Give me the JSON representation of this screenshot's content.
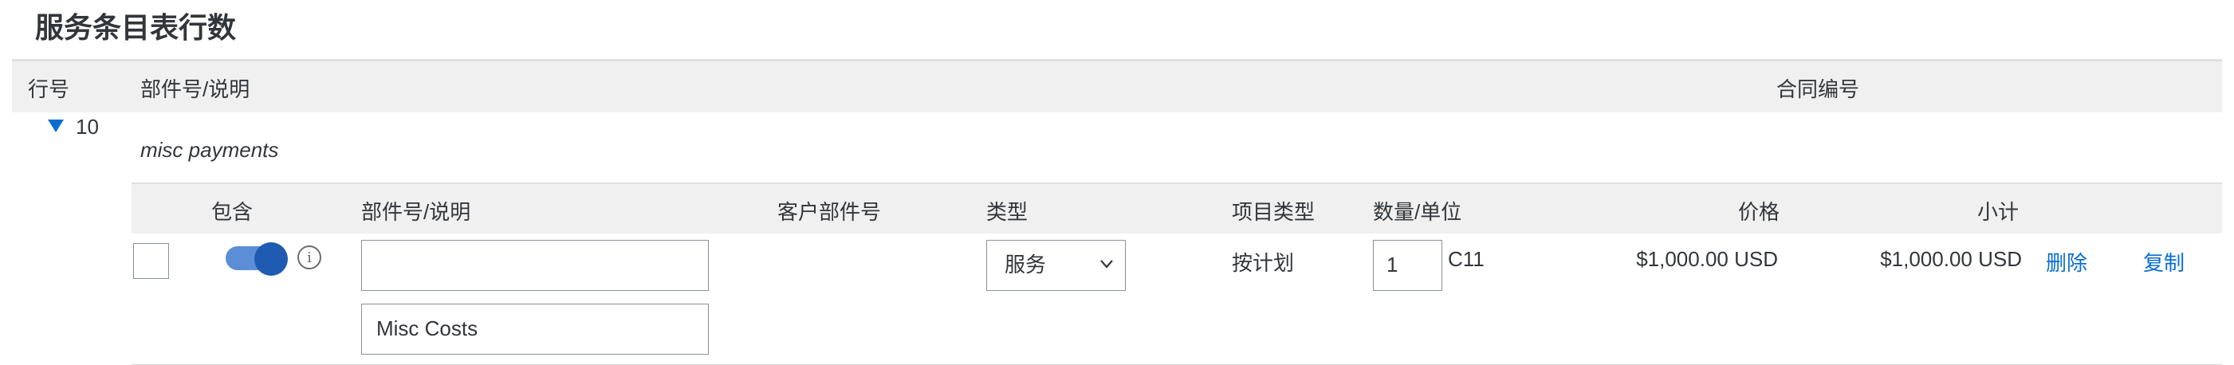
{
  "title": "服务条目表行数",
  "header": {
    "line_no": "行号",
    "part_desc": "部件号/说明",
    "contract_no": "合同编号"
  },
  "line": {
    "number": "10",
    "description": "misc payments"
  },
  "sub_header": {
    "include": "包含",
    "part_desc": "部件号/说明",
    "customer_part": "客户部件号",
    "type": "类型",
    "item_type": "项目类型",
    "qty_unit": "数量/单位",
    "price": "价格",
    "subtotal": "小计"
  },
  "item": {
    "part_input_value": "",
    "desc_input_value": "Misc Costs",
    "type_selected": "服务",
    "item_type": "按计划",
    "quantity": "1",
    "unit": "C11",
    "price": "$1,000.00 USD",
    "subtotal": "$1,000.00 USD",
    "delete_label": "删除",
    "copy_label": "复制",
    "include_toggle_on": true,
    "checkbox_checked": false
  },
  "icons": {
    "expand": "triangle-down-icon",
    "info": "info-icon",
    "dropdown": "chevron-down-icon"
  },
  "colors": {
    "accent": "#0a6ed1",
    "toggle_on": "#1f5bb0",
    "header_bg": "#f0f0f0"
  }
}
